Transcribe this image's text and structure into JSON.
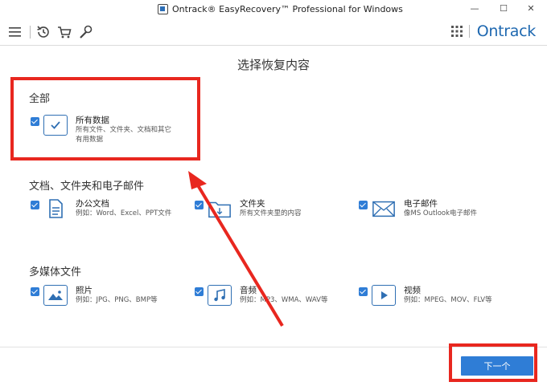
{
  "window": {
    "title": "Ontrack® EasyRecovery™ Professional for Windows",
    "min_glyph": "—",
    "max_glyph": "☐",
    "close_glyph": "✕"
  },
  "toolbar": {
    "brand": "Ontrack",
    "icons": [
      "menu-icon",
      "history-icon",
      "cart-icon",
      "wrench-icon",
      "apps-grid-icon"
    ]
  },
  "page": {
    "title": "选择恢复内容"
  },
  "sections": {
    "all": {
      "title": "全部",
      "items": [
        {
          "label": "所有数据",
          "desc1": "所有文件、文件夹、文档和其它",
          "desc2": "有用数据",
          "checked": true
        }
      ]
    },
    "docs": {
      "title": "文档、文件夹和电子邮件",
      "items": [
        {
          "label": "办公文档",
          "desc1": "例如：Word、Excel、PPT文件",
          "checked": true
        },
        {
          "label": "文件夹",
          "desc1": "所有文件夹里的内容",
          "checked": true
        },
        {
          "label": "电子邮件",
          "desc1": "像MS Outlook电子邮件",
          "checked": true
        }
      ]
    },
    "media": {
      "title": "多媒体文件",
      "items": [
        {
          "label": "照片",
          "desc1": "例如：JPG、PNG、BMP等",
          "checked": true
        },
        {
          "label": "音频",
          "desc1": "例如：MP3、WMA、WAV等",
          "checked": true
        },
        {
          "label": "视频",
          "desc1": "例如：MPEG、MOV、FLV等",
          "checked": true
        }
      ]
    }
  },
  "footer": {
    "next_label": "下一个"
  },
  "colors": {
    "accent": "#2f7dd6",
    "brand": "#1e68b0",
    "annotation": "#e8271f"
  }
}
